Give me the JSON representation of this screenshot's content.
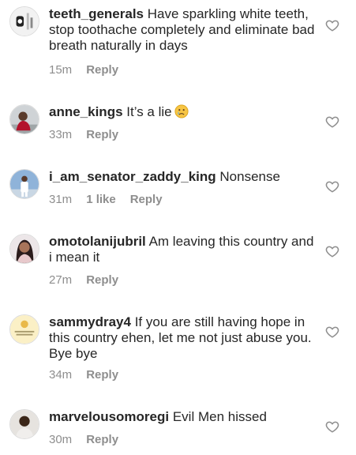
{
  "comments": [
    {
      "username": "teeth_generals",
      "text": "Have sparkling white teeth, stop toothache completely and eliminate bad breath naturally in days",
      "time": "15m",
      "likes": "",
      "reply": "Reply"
    },
    {
      "username": "anne_kings",
      "text": "It’s a lie",
      "emoji": "crying-face-emoji",
      "time": "33m",
      "likes": "",
      "reply": "Reply"
    },
    {
      "username": "i_am_senator_zaddy_king",
      "text": "Nonsense",
      "time": "31m",
      "likes": "1 like",
      "reply": "Reply"
    },
    {
      "username": "omotolanijubril",
      "text": "Am leaving this country and i mean it",
      "time": "27m",
      "likes": "",
      "reply": "Reply"
    },
    {
      "username": "sammydray4",
      "text": "If you are still having hope in this country ehen, let me not just abuse you. Bye bye",
      "time": "34m",
      "likes": "",
      "reply": "Reply"
    },
    {
      "username": "marvelousomoregi",
      "text": "Evil Men hissed",
      "time": "30m",
      "likes": "",
      "reply": "Reply"
    }
  ],
  "colors": {
    "text": "#262626",
    "muted": "#8e8e8e",
    "border": "#dbdbdb"
  }
}
